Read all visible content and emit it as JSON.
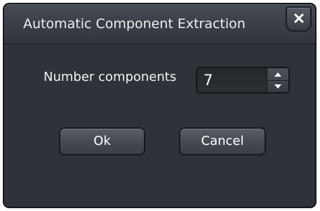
{
  "dialog": {
    "title": "Automatic Component Extraction",
    "close_icon": "close-x-icon"
  },
  "field": {
    "label": "Number components",
    "value": "7",
    "up_icon": "chevron-up-icon",
    "down_icon": "chevron-down-icon"
  },
  "buttons": {
    "ok_label": "Ok",
    "cancel_label": "Cancel"
  },
  "colors": {
    "background": "#2e3238",
    "titlebar": "#3b4048",
    "text": "#eef0f2",
    "border": "#15181c"
  }
}
